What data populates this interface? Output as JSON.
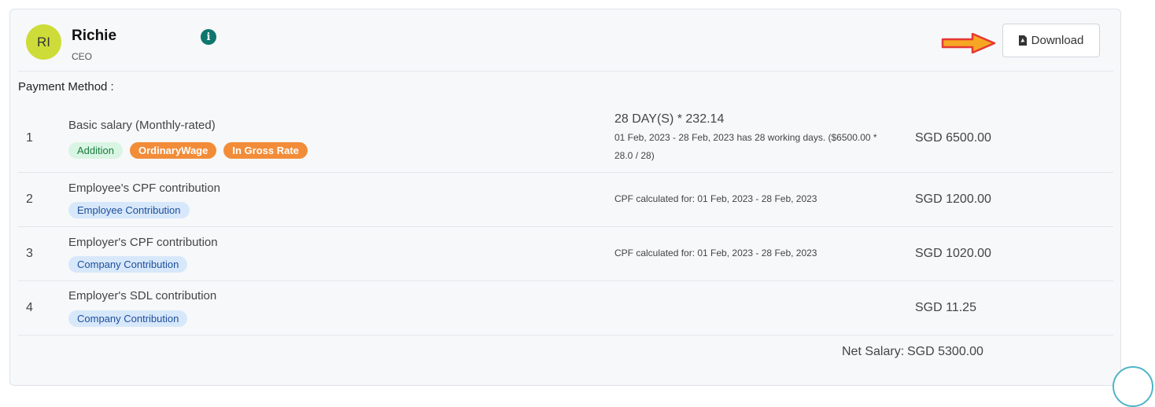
{
  "employee": {
    "initials": "RI",
    "name": "Richie",
    "role": "CEO"
  },
  "actions": {
    "download_label": "Download"
  },
  "payment_method_label": "Payment Method :",
  "rows": [
    {
      "num": "1",
      "name": "Basic salary (Monthly-rated)",
      "tags": [
        "Addition",
        "OrdinaryWage",
        "In Gross Rate"
      ],
      "detail_main": "28 DAY(S) * 232.14",
      "detail_sub": "01 Feb, 2023 - 28 Feb, 2023 has 28 working days. ($6500.00 * 28.0 / 28)",
      "amount": "SGD 6500.00"
    },
    {
      "num": "2",
      "name": "Employee's CPF contribution",
      "tags": [
        "Employee Contribution"
      ],
      "detail_sub": "CPF calculated for: 01 Feb, 2023 - 28 Feb, 2023",
      "amount": "SGD 1200.00"
    },
    {
      "num": "3",
      "name": "Employer's CPF contribution",
      "tags": [
        "Company Contribution"
      ],
      "detail_sub": "CPF calculated for: 01 Feb, 2023 - 28 Feb, 2023",
      "amount": "SGD 1020.00"
    },
    {
      "num": "4",
      "name": "Employer's SDL contribution",
      "tags": [
        "Company Contribution"
      ],
      "amount": "SGD 11.25"
    }
  ],
  "net": {
    "label": "Net Salary:",
    "amount": "SGD 5300.00"
  },
  "colors": {
    "avatar_bg": "#cddc39",
    "info_icon": "#0f766e",
    "arrow": "#e53935",
    "tag_addition_bg": "#d9f5e3",
    "tag_orange_bg": "#f28c38",
    "tag_blue_bg": "#d8e8fb"
  },
  "icons": {
    "info": "info-icon",
    "arrow": "right-arrow-icon",
    "download": "pdf-file-icon"
  }
}
